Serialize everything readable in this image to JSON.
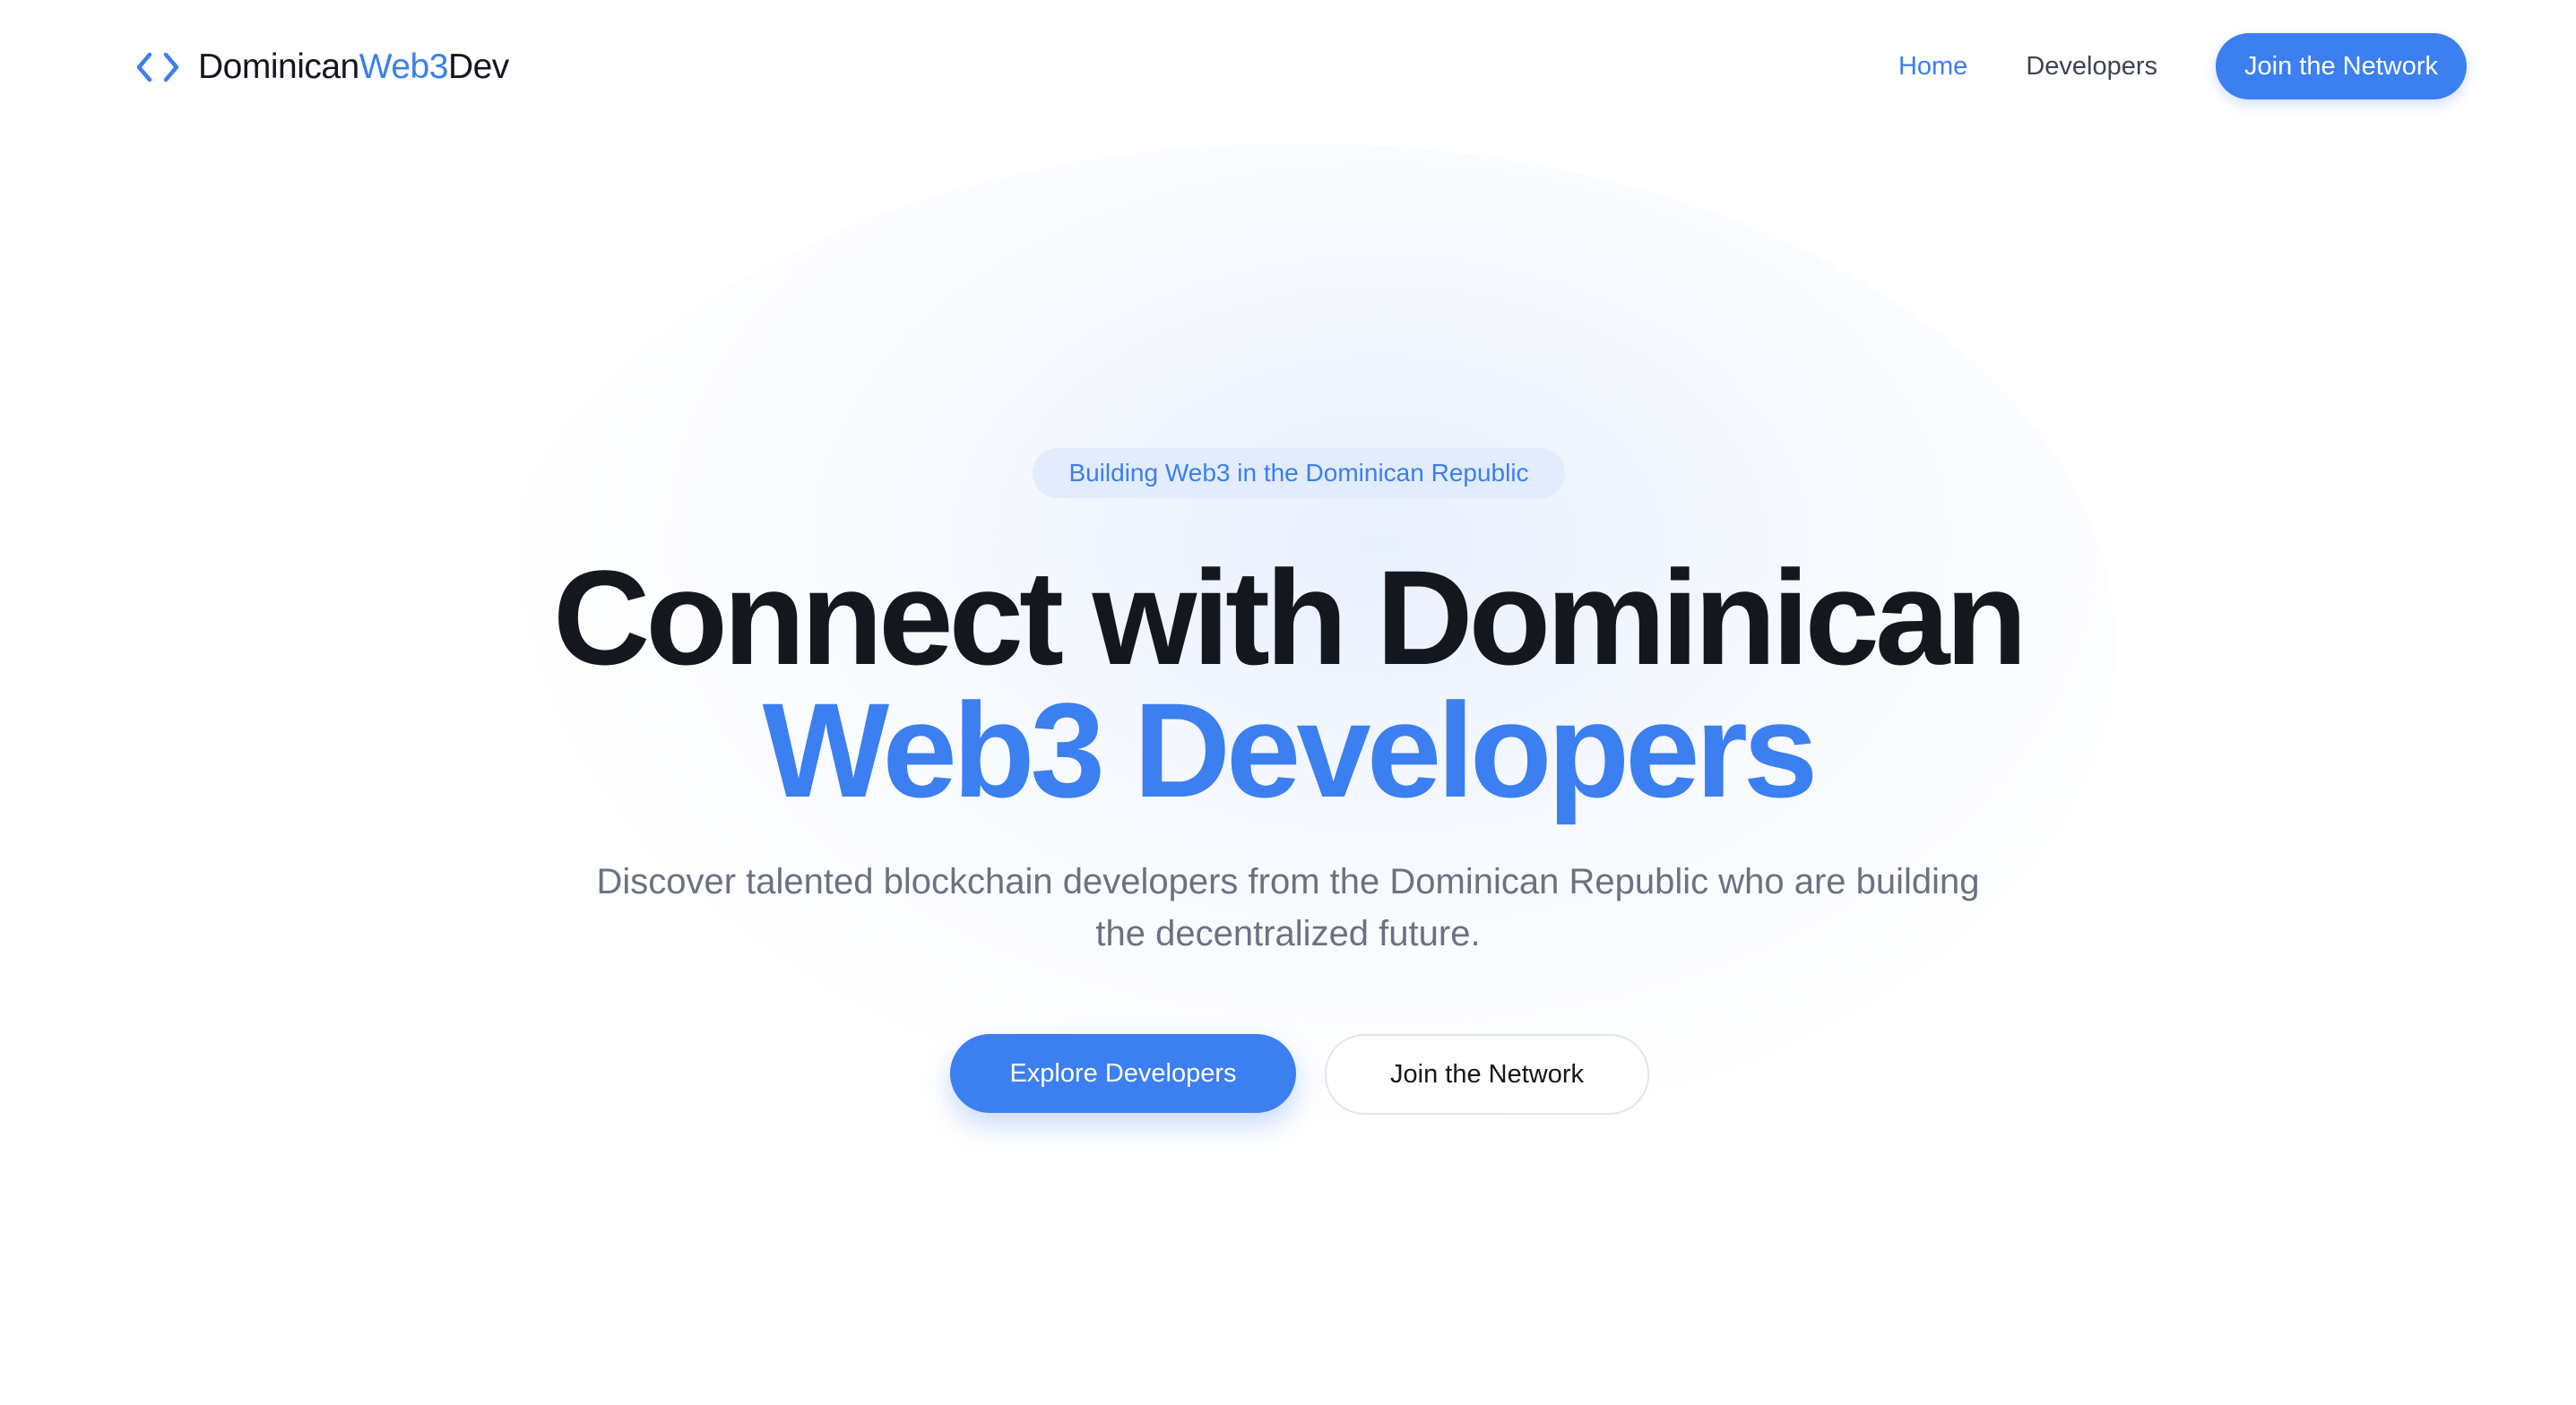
{
  "header": {
    "logo": {
      "part1": "Dominican",
      "part2": "Web3",
      "part3": "Dev",
      "icon": "code-brackets-icon"
    },
    "nav": {
      "home": "Home",
      "developers": "Developers",
      "cta": "Join the Network"
    }
  },
  "hero": {
    "badge": "Building Web3 in the Dominican Republic",
    "headline_line1": "Connect with Dominican",
    "headline_line2": "Web3 Developers",
    "subtitle": "Discover talented blockchain developers from the Dominican Republic who are building the decentralized future.",
    "primary_button": "Explore Developers",
    "secondary_button": "Join the Network"
  },
  "colors": {
    "accent": "#3b7ff0",
    "text_dark": "#15171f",
    "text_muted": "#6a7282",
    "badge_bg": "#e3ecfc"
  }
}
